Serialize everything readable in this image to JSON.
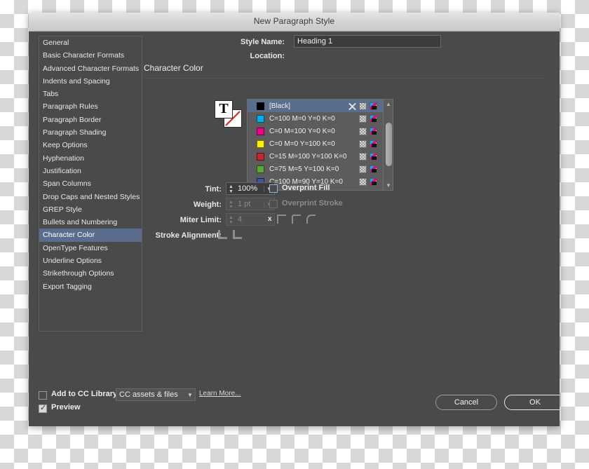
{
  "window": {
    "title": "New Paragraph Style"
  },
  "sidebar": {
    "items": [
      {
        "label": "General",
        "selected": false
      },
      {
        "label": "Basic Character Formats",
        "selected": false
      },
      {
        "label": "Advanced Character Formats",
        "selected": false
      },
      {
        "label": "Indents and Spacing",
        "selected": false
      },
      {
        "label": "Tabs",
        "selected": false
      },
      {
        "label": "Paragraph Rules",
        "selected": false
      },
      {
        "label": "Paragraph Border",
        "selected": false
      },
      {
        "label": "Paragraph Shading",
        "selected": false
      },
      {
        "label": "Keep Options",
        "selected": false
      },
      {
        "label": "Hyphenation",
        "selected": false
      },
      {
        "label": "Justification",
        "selected": false
      },
      {
        "label": "Span Columns",
        "selected": false
      },
      {
        "label": "Drop Caps and Nested Styles",
        "selected": false
      },
      {
        "label": "GREP Style",
        "selected": false
      },
      {
        "label": "Bullets and Numbering",
        "selected": false
      },
      {
        "label": "Character Color",
        "selected": true
      },
      {
        "label": "OpenType Features",
        "selected": false
      },
      {
        "label": "Underline Options",
        "selected": false
      },
      {
        "label": "Strikethrough Options",
        "selected": false
      },
      {
        "label": "Export Tagging",
        "selected": false
      }
    ]
  },
  "header": {
    "style_name_label": "Style Name:",
    "style_name_value": "Heading 1",
    "location_label": "Location:",
    "location_value": ""
  },
  "section": {
    "title": "Character Color"
  },
  "proxy": {
    "fill_glyph": "T",
    "fill_name": "text-fill-proxy",
    "stroke_name": "text-stroke-proxy-none"
  },
  "swatches": {
    "rows": [
      {
        "name": "[Black]",
        "color": "#000000",
        "selected": true,
        "has_none_icon": true
      },
      {
        "name": "C=100 M=0 Y=0 K=0",
        "color": "#00aeef",
        "selected": false,
        "has_none_icon": false
      },
      {
        "name": "C=0 M=100 Y=0 K=0",
        "color": "#ec008c",
        "selected": false,
        "has_none_icon": false
      },
      {
        "name": "C=0 M=0 Y=100 K=0",
        "color": "#fff200",
        "selected": false,
        "has_none_icon": false
      },
      {
        "name": "C=15 M=100 Y=100 K=0",
        "color": "#c1272d",
        "selected": false,
        "has_none_icon": false
      },
      {
        "name": "C=75 M=5 Y=100 K=0",
        "color": "#5aa839",
        "selected": false,
        "has_none_icon": false
      },
      {
        "name": "C=100 M=90 Y=10 K=0",
        "color": "#3b53a4",
        "selected": false,
        "has_none_icon": false
      }
    ],
    "scrollbar": {
      "up_glyph": "▲",
      "down_glyph": "▼"
    }
  },
  "controls": {
    "tint_label": "Tint:",
    "tint_value": "100%",
    "weight_label": "Weight:",
    "weight_value": "1 pt",
    "miter_label": "Miter Limit:",
    "miter_value": "4",
    "miter_times": "x",
    "stroke_align_label": "Stroke Alignment:",
    "overprint_fill_label": "Overprint Fill",
    "overprint_fill_checked": false,
    "overprint_stroke_label": "Overprint Stroke",
    "overprint_stroke_checked": false
  },
  "footer": {
    "cc_library_label": "Add to CC Library:",
    "cc_library_checked": false,
    "cc_library_option": "CC assets & files",
    "learn_more_label": "Learn More...",
    "preview_label": "Preview",
    "preview_checked": true,
    "cancel_label": "Cancel",
    "ok_label": "OK"
  }
}
